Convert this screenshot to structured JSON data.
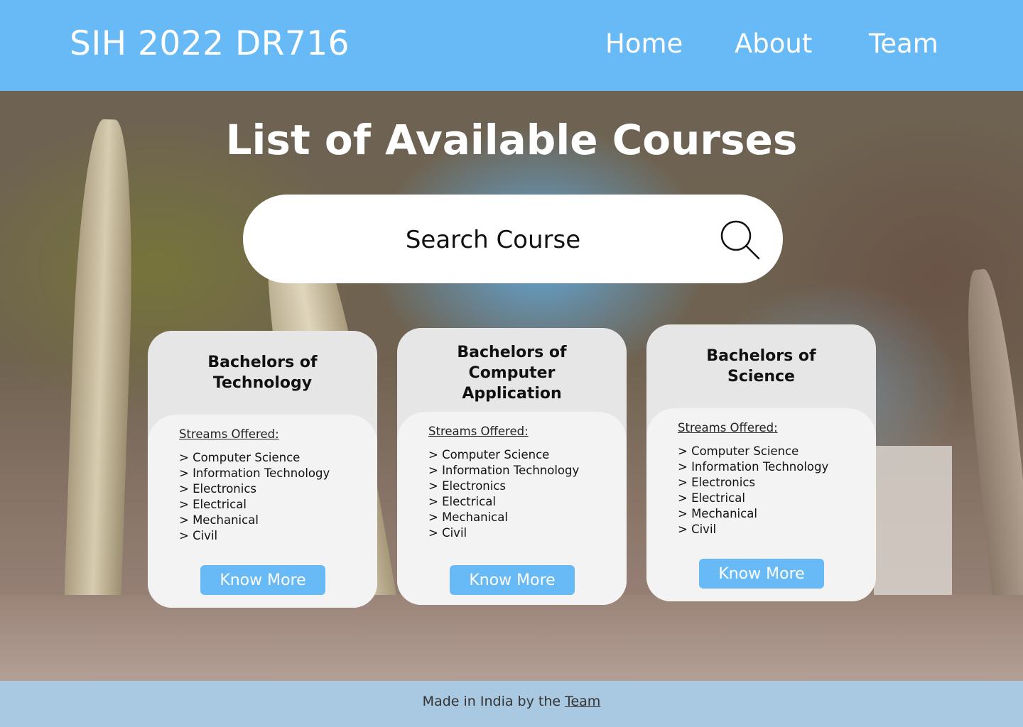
{
  "header": {
    "brand": "SIH 2022 DR716",
    "nav": [
      "Home",
      "About",
      "Team"
    ]
  },
  "main": {
    "title": "List of Available Courses",
    "search": {
      "placeholder": "Search Course",
      "icon": "search-icon"
    }
  },
  "courses": [
    {
      "title_lines": [
        "Bachelors of",
        "Technology"
      ],
      "streams_label": "Streams Offered:",
      "streams": [
        "> Computer Science",
        "> Information Technology",
        "> Electronics",
        "> Electrical",
        "> Mechanical",
        "> Civil"
      ],
      "button": "Know More"
    },
    {
      "title_lines": [
        "Bachelors of",
        "Computer",
        "Application"
      ],
      "streams_label": "Streams Offered:",
      "streams": [
        "> Computer Science",
        "> Information Technology",
        "> Electronics",
        "> Electrical",
        "> Mechanical",
        "> Civil"
      ],
      "button": "Know More"
    },
    {
      "title_lines": [
        "Bachelors of",
        "Science"
      ],
      "streams_label": "Streams Offered:",
      "streams": [
        "> Computer Science",
        "> Information Technology",
        "> Electronics",
        "> Electrical",
        "> Mechanical",
        "> Civil"
      ],
      "button": "Know More"
    }
  ],
  "footer": {
    "text": "Made in India by the ",
    "link": "Team"
  },
  "colors": {
    "accent": "#67baf6",
    "footer_bg": "#a9c8e1",
    "card_head": "#e6e6e6",
    "card_body": "#f4f3f3"
  }
}
